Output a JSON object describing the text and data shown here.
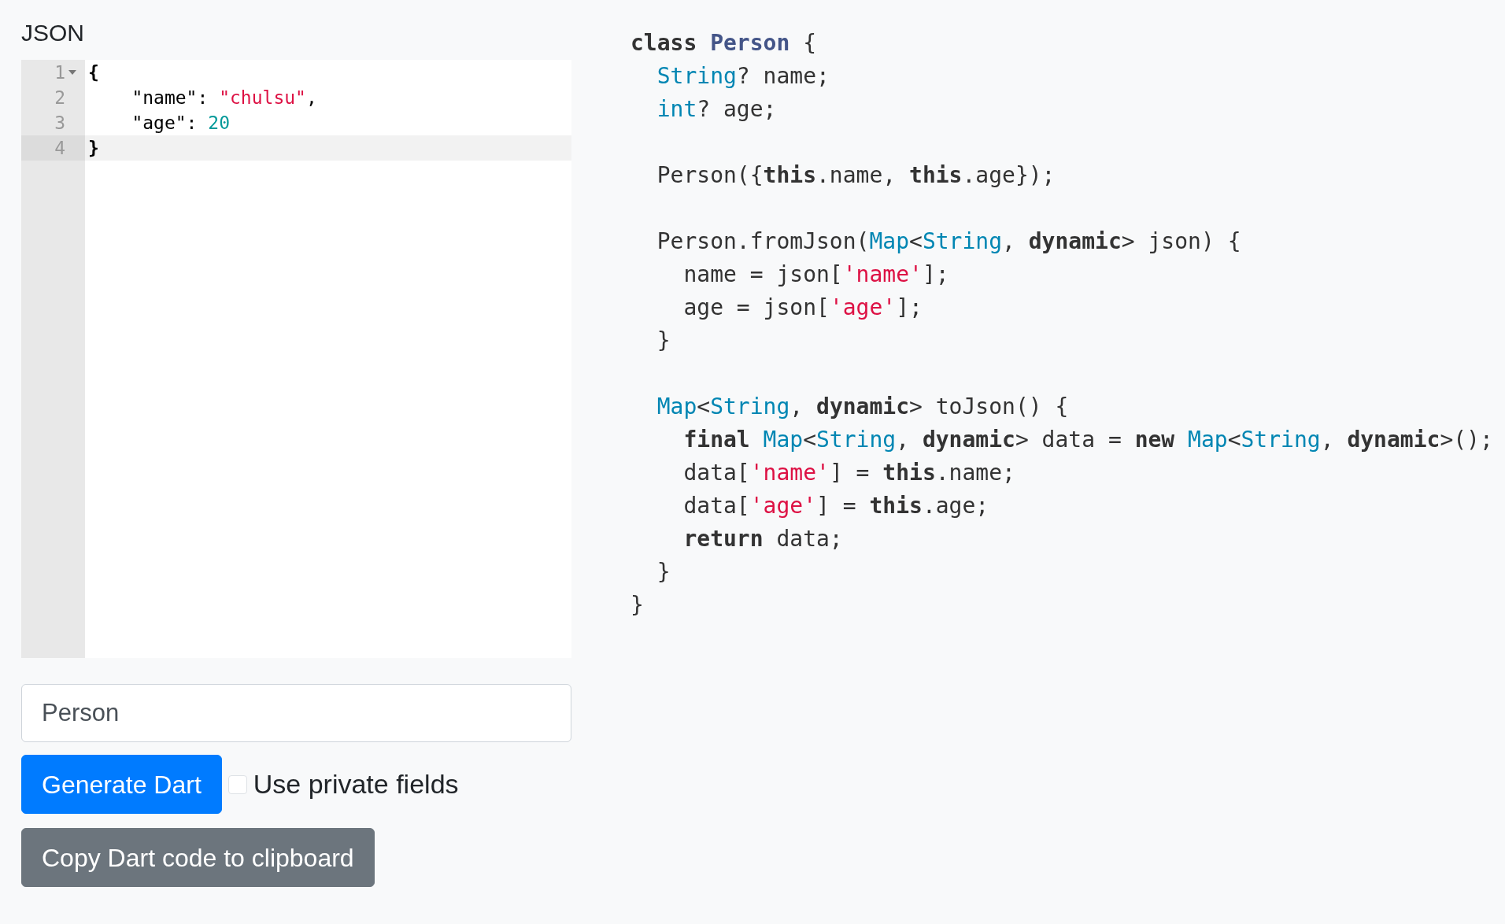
{
  "editor": {
    "title": "JSON",
    "lines": [
      {
        "number": "1",
        "foldable": true,
        "active": false,
        "tokens": [
          {
            "kind": "punct",
            "text": "{"
          }
        ]
      },
      {
        "number": "2",
        "foldable": false,
        "active": false,
        "tokens": [
          {
            "kind": "plain",
            "text": "    \"name\": "
          },
          {
            "kind": "string",
            "text": "\"chulsu\""
          },
          {
            "kind": "plain",
            "text": ","
          }
        ]
      },
      {
        "number": "3",
        "foldable": false,
        "active": false,
        "tokens": [
          {
            "kind": "plain",
            "text": "    \"age\": "
          },
          {
            "kind": "number",
            "text": "20"
          }
        ]
      },
      {
        "number": "4",
        "foldable": false,
        "active": true,
        "tokens": [
          {
            "kind": "punct",
            "text": "}"
          }
        ]
      }
    ]
  },
  "class_name_field": {
    "value": "Person"
  },
  "generate_button": {
    "label": "Generate Dart"
  },
  "private_fields": {
    "label": "Use private fields",
    "checked": false
  },
  "copy_button": {
    "label": "Copy Dart code to clipboard"
  },
  "output": {
    "lines": [
      {
        "gap_before": false,
        "tokens": [
          {
            "kind": "keyword",
            "text": "class"
          },
          {
            "kind": "classname",
            "text": " Person"
          },
          {
            "kind": "plain",
            "text": " {"
          }
        ]
      },
      {
        "gap_before": false,
        "tokens": [
          {
            "kind": "type",
            "text": "  String"
          },
          {
            "kind": "plain",
            "text": "? name;"
          }
        ]
      },
      {
        "gap_before": false,
        "tokens": [
          {
            "kind": "type",
            "text": "  int"
          },
          {
            "kind": "plain",
            "text": "? age;"
          }
        ]
      },
      {
        "gap_before": true,
        "tokens": [
          {
            "kind": "plain",
            "text": "  Person({"
          },
          {
            "kind": "keyword",
            "text": "this"
          },
          {
            "kind": "plain",
            "text": ".name, "
          },
          {
            "kind": "keyword",
            "text": "this"
          },
          {
            "kind": "plain",
            "text": ".age});"
          }
        ]
      },
      {
        "gap_before": true,
        "tokens": [
          {
            "kind": "plain",
            "text": "  Person.fromJson("
          },
          {
            "kind": "type",
            "text": "Map"
          },
          {
            "kind": "plain",
            "text": "<"
          },
          {
            "kind": "type",
            "text": "String"
          },
          {
            "kind": "plain",
            "text": ", "
          },
          {
            "kind": "keyword",
            "text": "dynamic"
          },
          {
            "kind": "plain",
            "text": "> json) {"
          }
        ]
      },
      {
        "gap_before": false,
        "tokens": [
          {
            "kind": "plain",
            "text": "    name = json["
          },
          {
            "kind": "string",
            "text": "'name'"
          },
          {
            "kind": "plain",
            "text": "];"
          }
        ]
      },
      {
        "gap_before": false,
        "tokens": [
          {
            "kind": "plain",
            "text": "    age = json["
          },
          {
            "kind": "string",
            "text": "'age'"
          },
          {
            "kind": "plain",
            "text": "];"
          }
        ]
      },
      {
        "gap_before": false,
        "tokens": [
          {
            "kind": "plain",
            "text": "  }"
          }
        ]
      },
      {
        "gap_before": true,
        "tokens": [
          {
            "kind": "type",
            "text": "  Map"
          },
          {
            "kind": "plain",
            "text": "<"
          },
          {
            "kind": "type",
            "text": "String"
          },
          {
            "kind": "plain",
            "text": ", "
          },
          {
            "kind": "keyword",
            "text": "dynamic"
          },
          {
            "kind": "plain",
            "text": "> toJson() {"
          }
        ]
      },
      {
        "gap_before": false,
        "tokens": [
          {
            "kind": "keyword",
            "text": "    final"
          },
          {
            "kind": "type",
            "text": " Map"
          },
          {
            "kind": "plain",
            "text": "<"
          },
          {
            "kind": "type",
            "text": "String"
          },
          {
            "kind": "plain",
            "text": ", "
          },
          {
            "kind": "keyword",
            "text": "dynamic"
          },
          {
            "kind": "plain",
            "text": "> data = "
          },
          {
            "kind": "keyword",
            "text": "new"
          },
          {
            "kind": "type",
            "text": " Map"
          },
          {
            "kind": "plain",
            "text": "<"
          },
          {
            "kind": "type",
            "text": "String"
          },
          {
            "kind": "plain",
            "text": ", "
          },
          {
            "kind": "keyword",
            "text": "dynamic"
          },
          {
            "kind": "plain",
            "text": ">();"
          }
        ]
      },
      {
        "gap_before": false,
        "tokens": [
          {
            "kind": "plain",
            "text": "    data["
          },
          {
            "kind": "string",
            "text": "'name'"
          },
          {
            "kind": "plain",
            "text": "] = "
          },
          {
            "kind": "keyword",
            "text": "this"
          },
          {
            "kind": "plain",
            "text": ".name;"
          }
        ]
      },
      {
        "gap_before": false,
        "tokens": [
          {
            "kind": "plain",
            "text": "    data["
          },
          {
            "kind": "string",
            "text": "'age'"
          },
          {
            "kind": "plain",
            "text": "] = "
          },
          {
            "kind": "keyword",
            "text": "this"
          },
          {
            "kind": "plain",
            "text": ".age;"
          }
        ]
      },
      {
        "gap_before": false,
        "tokens": [
          {
            "kind": "keyword",
            "text": "    return"
          },
          {
            "kind": "plain",
            "text": " data;"
          }
        ]
      },
      {
        "gap_before": false,
        "tokens": [
          {
            "kind": "plain",
            "text": "  }"
          }
        ]
      },
      {
        "gap_before": false,
        "tokens": [
          {
            "kind": "plain",
            "text": "}"
          }
        ]
      }
    ]
  }
}
